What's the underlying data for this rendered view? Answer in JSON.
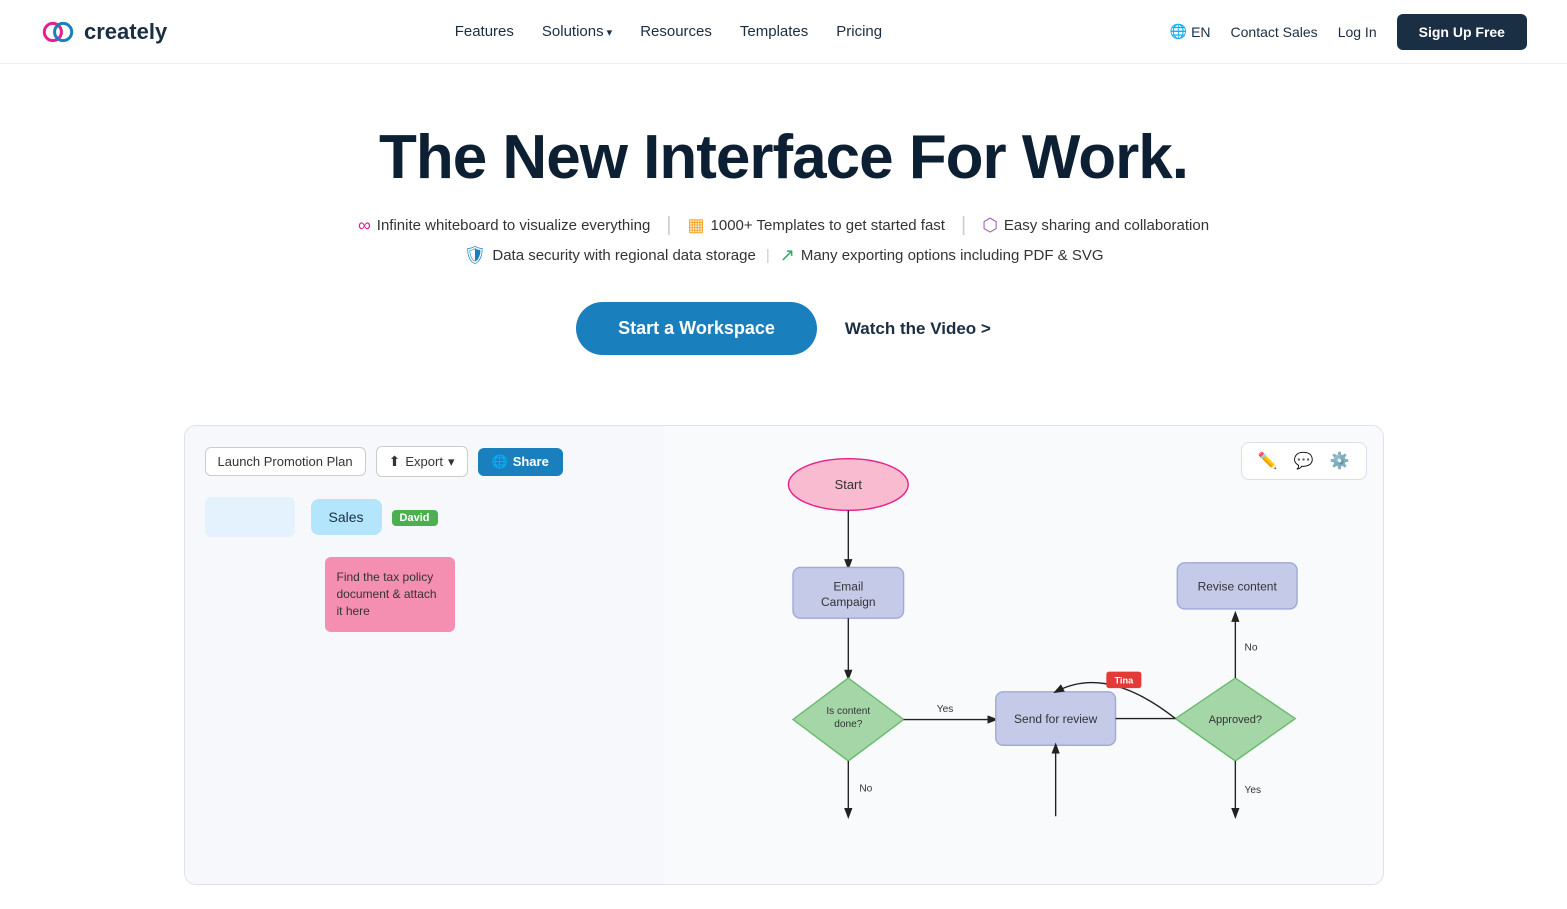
{
  "nav": {
    "logo_text": "creately",
    "links": [
      {
        "label": "Features",
        "has_arrow": false
      },
      {
        "label": "Solutions",
        "has_arrow": true
      },
      {
        "label": "Resources",
        "has_arrow": false
      },
      {
        "label": "Templates",
        "has_arrow": false
      },
      {
        "label": "Pricing",
        "has_arrow": false
      }
    ],
    "lang": "EN",
    "contact_sales": "Contact Sales",
    "login": "Log In",
    "signup": "Sign Up Free"
  },
  "hero": {
    "headline": "The New Interface For Work.",
    "features_row1": [
      {
        "icon": "∞",
        "icon_color": "#e91e8c",
        "text": "Infinite whiteboard to visualize everything"
      },
      {
        "icon": "▦",
        "icon_color": "#f5a623",
        "text": "1000+ Templates to get started fast"
      },
      {
        "icon": "⬡",
        "icon_color": "#9b59b6",
        "text": "Easy sharing and collaboration"
      }
    ],
    "features_row2": [
      {
        "icon": "🛡",
        "icon_color": "#1a7fbd",
        "text": "Data security with regional data storage"
      },
      {
        "icon": "↗",
        "icon_color": "#27ae60",
        "text": "Many exporting options including PDF & SVG"
      }
    ],
    "cta_start": "Start a Workspace",
    "cta_watch": "Watch the Video >"
  },
  "demo": {
    "doc_title": "Launch Promotion Plan",
    "export_label": "Export",
    "share_label": "Share",
    "kanban": {
      "col1_items": [
        {
          "text": "Sales",
          "tag": "David"
        }
      ],
      "sticky_text": "Find the tax policy document & attach it here"
    },
    "flowchart": {
      "nodes": [
        {
          "id": "start",
          "label": "Start",
          "type": "oval"
        },
        {
          "id": "email",
          "label": "Email Campaign",
          "type": "rect"
        },
        {
          "id": "decision1",
          "label": "Is content done?",
          "type": "diamond"
        },
        {
          "id": "review",
          "label": "Send for review",
          "type": "rect"
        },
        {
          "id": "approved",
          "label": "Approved?",
          "type": "diamond"
        },
        {
          "id": "revise",
          "label": "Revise content",
          "type": "rect"
        }
      ],
      "labels": {
        "yes": "Yes",
        "no": "No",
        "tina": "Tina"
      }
    }
  }
}
